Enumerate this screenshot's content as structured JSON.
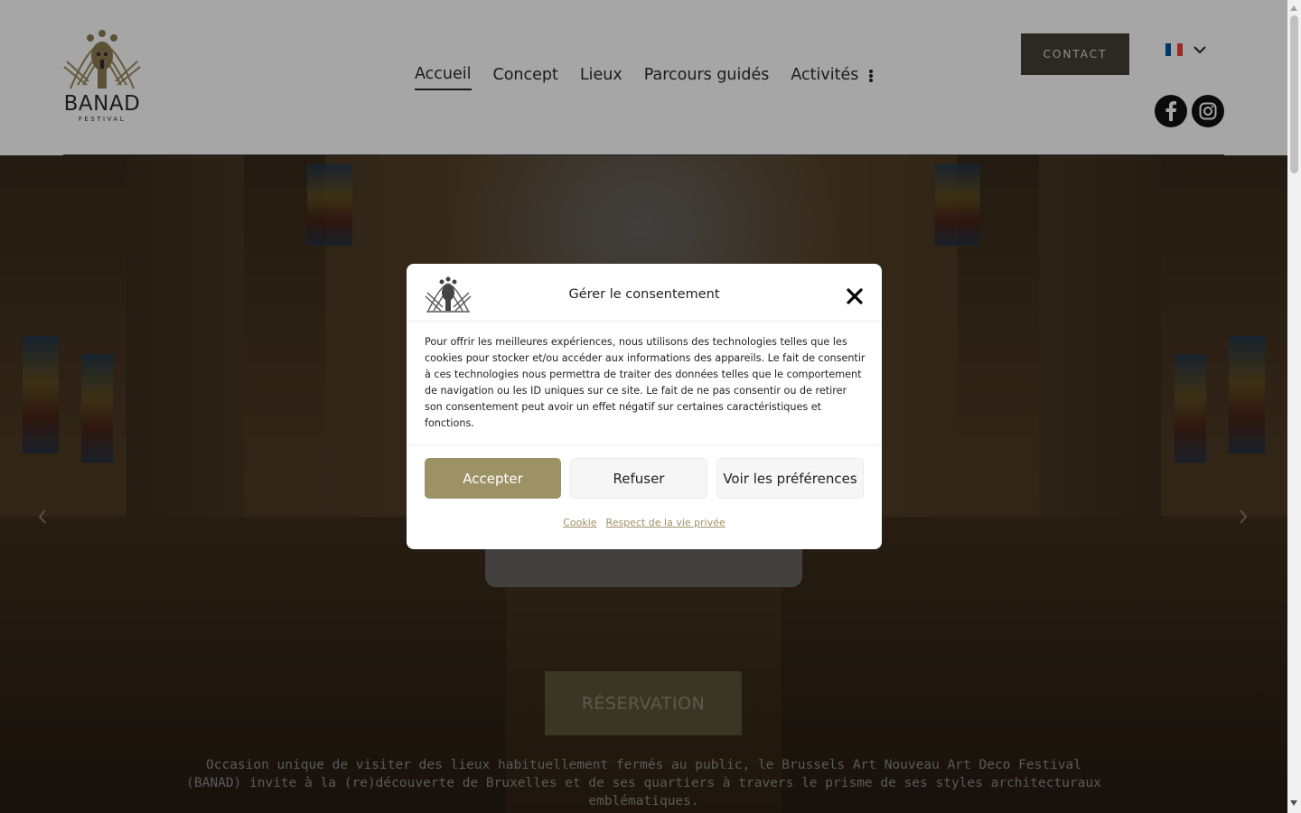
{
  "header": {
    "logo": {
      "name": "BANAD",
      "sub": "FESTIVAL"
    },
    "nav": [
      {
        "label": "Accueil",
        "active": true
      },
      {
        "label": "Concept",
        "active": false
      },
      {
        "label": "Lieux",
        "active": false
      },
      {
        "label": "Parcours guidés",
        "active": false
      },
      {
        "label": "Activités",
        "active": false
      }
    ],
    "more_icon": "vertical-dots-icon",
    "contact_label": "CONTACT",
    "language": {
      "flag": "fr-flag-icon",
      "flag_colors": [
        "#0055a4",
        "#ffffff",
        "#ef4135"
      ],
      "chevron": "chevron-down-icon"
    },
    "social": [
      "facebook-icon",
      "instagram-icon"
    ]
  },
  "hero": {
    "reservation_label": "RÉSERVATION",
    "description": "Occasion unique de visiter des lieux habituellement fermés au public, le Brussels Art Nouveau Art Deco Festival (BANAD) invite à la (re)découverte de Bruxelles et de ses quartiers à travers le prisme de ses styles architecturaux emblématiques.",
    "prev_icon": "chevron-left-icon",
    "next_icon": "chevron-right-icon"
  },
  "consent": {
    "title": "Gérer le consentement",
    "body": "Pour offrir les meilleures expériences, nous utilisons des technologies telles que les cookies pour stocker et/ou accéder aux informations des appareils. Le fait de consentir à ces technologies nous permettra de traiter des données telles que le comportement de navigation ou les ID uniques sur ce site. Le fait de ne pas consentir ou de retirer son consentement peut avoir un effet négatif sur certaines caractéristiques et fonctions.",
    "accept_label": "Accepter",
    "refuse_label": "Refuser",
    "prefs_label": "Voir les préférences",
    "links": [
      "Cookie",
      "Respect de la vie privée"
    ],
    "close_icon": "close-icon"
  },
  "colors": {
    "accent": "#9d9166",
    "contact_bg": "#444036",
    "text": "#222222"
  }
}
